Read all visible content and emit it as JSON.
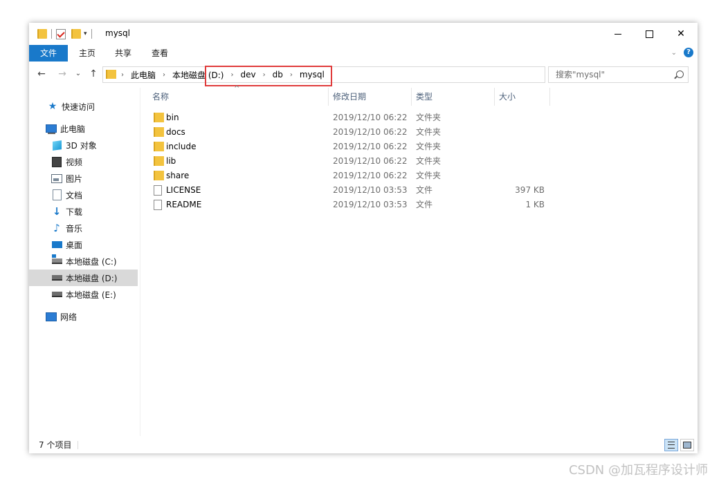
{
  "window": {
    "title": "mysql",
    "qa_arrow": "▾",
    "controls": {
      "minimize": "",
      "maximize": "",
      "close": "✕"
    }
  },
  "ribbon": {
    "tabs": [
      "文件",
      "主页",
      "共享",
      "查看"
    ],
    "expand_icon": "⌄",
    "help_label": "?"
  },
  "address": {
    "back": "←",
    "forward": "→",
    "recent": "⌄",
    "up": "↑",
    "crumbs": [
      "此电脑",
      "本地磁盘 (D:)",
      "dev",
      "db",
      "mysql"
    ],
    "separator": "›",
    "dropdown": "⌄",
    "refresh": "↻"
  },
  "search": {
    "placeholder": "搜索\"mysql\""
  },
  "nav": {
    "items": [
      {
        "label": "快速访问",
        "icon": "star-icon"
      },
      {
        "label": "此电脑",
        "icon": "computer-icon"
      },
      {
        "label": "3D 对象",
        "icon": "3d-objects-icon"
      },
      {
        "label": "视频",
        "icon": "video-icon"
      },
      {
        "label": "图片",
        "icon": "pictures-icon"
      },
      {
        "label": "文档",
        "icon": "documents-icon"
      },
      {
        "label": "下载",
        "icon": "download-icon"
      },
      {
        "label": "音乐",
        "icon": "music-icon"
      },
      {
        "label": "桌面",
        "icon": "desktop-icon"
      },
      {
        "label": "本地磁盘 (C:)",
        "icon": "drive-c-icon"
      },
      {
        "label": "本地磁盘 (D:)",
        "icon": "drive-icon",
        "selected": true
      },
      {
        "label": "本地磁盘 (E:)",
        "icon": "drive-icon"
      },
      {
        "label": "网络",
        "icon": "network-icon"
      }
    ]
  },
  "list": {
    "columns": {
      "name": "名称",
      "date": "修改日期",
      "type": "类型",
      "size": "大小"
    },
    "sort_glyph": "^",
    "rows": [
      {
        "name": "bin",
        "date": "2019/12/10 06:22",
        "type": "文件夹",
        "size": "",
        "kind": "folder"
      },
      {
        "name": "docs",
        "date": "2019/12/10 06:22",
        "type": "文件夹",
        "size": "",
        "kind": "folder"
      },
      {
        "name": "include",
        "date": "2019/12/10 06:22",
        "type": "文件夹",
        "size": "",
        "kind": "folder"
      },
      {
        "name": "lib",
        "date": "2019/12/10 06:22",
        "type": "文件夹",
        "size": "",
        "kind": "folder"
      },
      {
        "name": "share",
        "date": "2019/12/10 06:22",
        "type": "文件夹",
        "size": "",
        "kind": "folder"
      },
      {
        "name": "LICENSE",
        "date": "2019/12/10 03:53",
        "type": "文件",
        "size": "397 KB",
        "kind": "file"
      },
      {
        "name": "README",
        "date": "2019/12/10 03:53",
        "type": "文件",
        "size": "1 KB",
        "kind": "file"
      }
    ]
  },
  "status": {
    "count": "7 个项目"
  },
  "colors": {
    "accent": "#1979ca",
    "highlight": "#e03b3b",
    "folder": "#f3c33e"
  },
  "watermark": "CSDN @加瓦程序设计师"
}
